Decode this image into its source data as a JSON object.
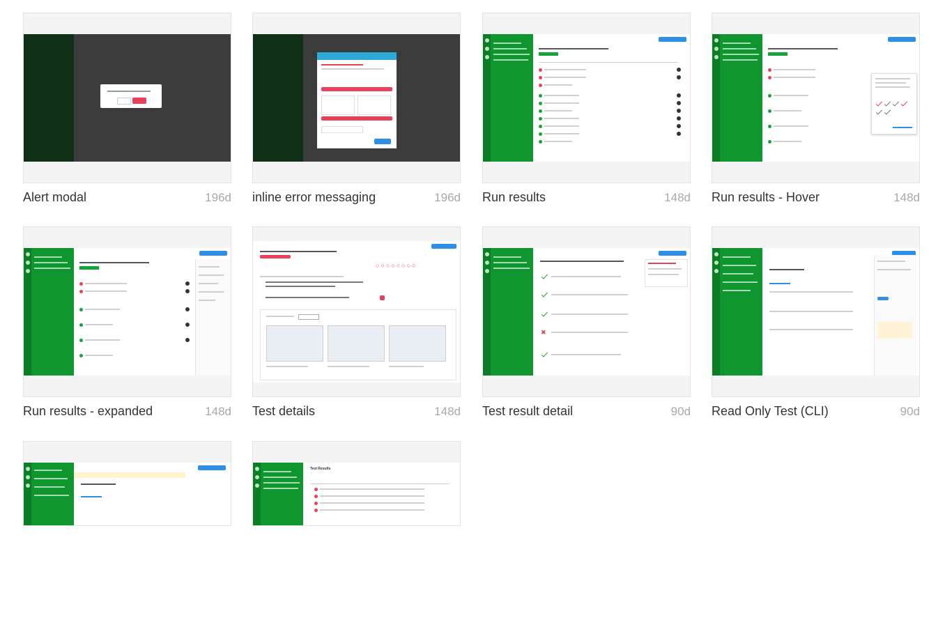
{
  "cards": [
    {
      "name": "Alert modal",
      "age": "196d"
    },
    {
      "name": "inline error messaging",
      "age": "196d"
    },
    {
      "name": "Run results",
      "age": "148d"
    },
    {
      "name": "Run results - Hover",
      "age": "148d"
    },
    {
      "name": "Run results - expanded",
      "age": "148d"
    },
    {
      "name": "Test details",
      "age": "148d"
    },
    {
      "name": "Test result detail",
      "age": "90d"
    },
    {
      "name": "Read Only Test (CLI)",
      "age": "90d"
    },
    {
      "name": "",
      "age": ""
    },
    {
      "name": "",
      "age": ""
    }
  ],
  "thumbs": {
    "test_results_heading": "Test Results"
  },
  "colors": {
    "brand_green": "#10962f",
    "accent_blue": "#2f8fe8",
    "error_red": "#e84158"
  }
}
